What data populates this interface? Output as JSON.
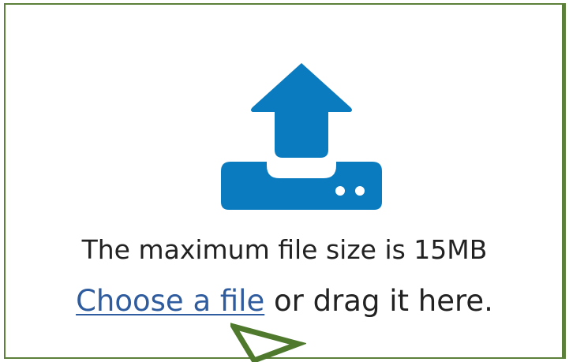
{
  "icons": {
    "upload": "upload-tray-icon",
    "cursor": "arrow-cursor-icon"
  },
  "colors": {
    "border": "#5c7f3a",
    "icon": "#0a7bbf",
    "link": "#2f5c9e",
    "text": "#222222",
    "cursor": "#4f7a2d"
  },
  "upload": {
    "max_size_text": "The maximum file size is 15MB",
    "choose_link": "Choose a file",
    "drag_text": " or drag it here."
  }
}
